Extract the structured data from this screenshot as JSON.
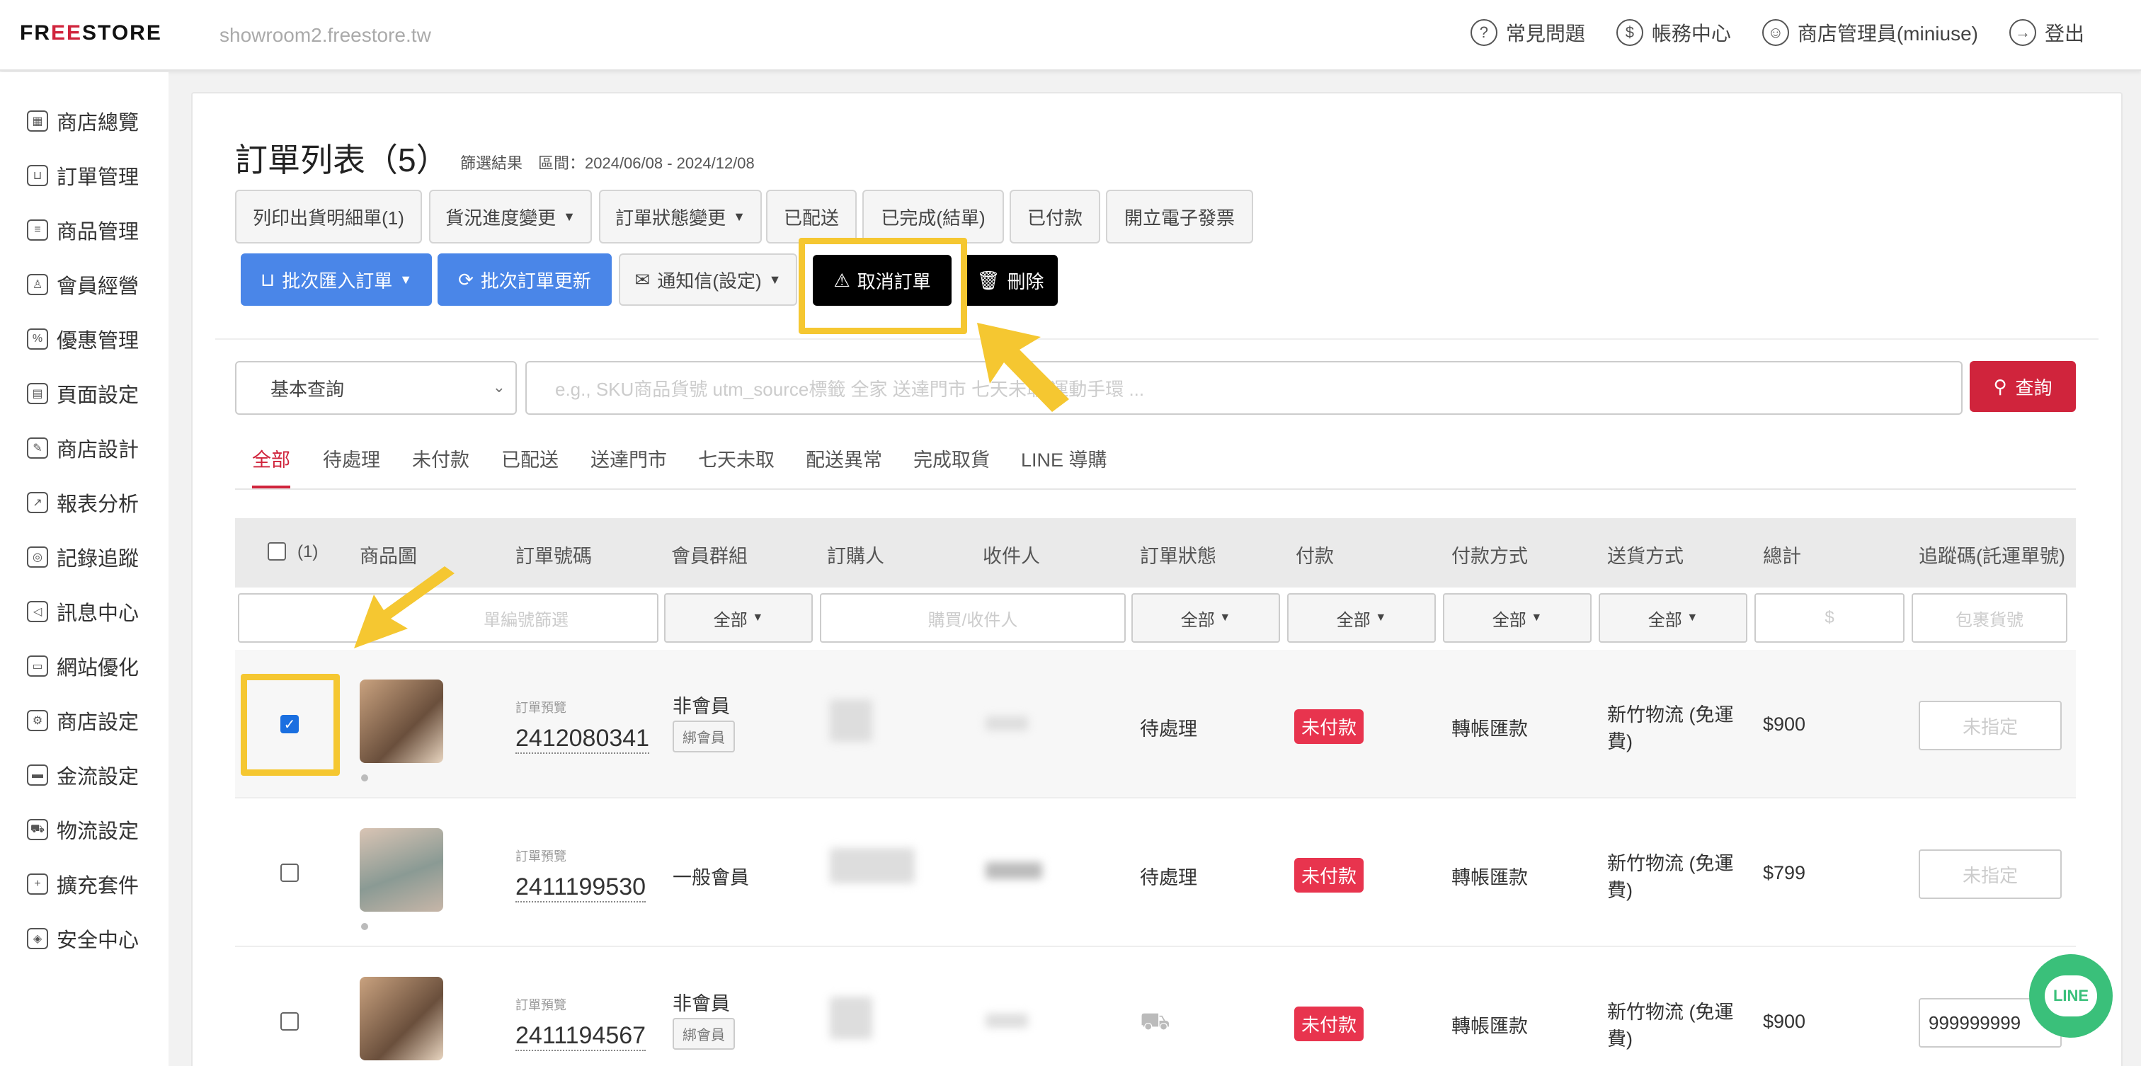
{
  "header": {
    "logo": "FREESTORE",
    "domain": "showroom2.freestore.tw",
    "nav": [
      {
        "icon": "question-icon",
        "label": "常見問題"
      },
      {
        "icon": "dollar-icon",
        "label": "帳務中心"
      },
      {
        "icon": "user-icon",
        "label": "商店管理員(miniuse)"
      },
      {
        "icon": "logout-icon",
        "label": "登出"
      }
    ]
  },
  "sidebar": {
    "items": [
      {
        "label": "商店總覽"
      },
      {
        "label": "訂單管理"
      },
      {
        "label": "商品管理"
      },
      {
        "label": "會員經營"
      },
      {
        "label": "優惠管理"
      },
      {
        "label": "頁面設定"
      },
      {
        "label": "商店設計"
      },
      {
        "label": "報表分析"
      },
      {
        "label": "記錄追蹤"
      },
      {
        "label": "訊息中心"
      },
      {
        "label": "網站優化"
      },
      {
        "label": "商店設定"
      },
      {
        "label": "金流設定"
      },
      {
        "label": "物流設定"
      },
      {
        "label": "擴充套件"
      },
      {
        "label": "安全中心"
      }
    ]
  },
  "main": {
    "title": "訂單列表（5）",
    "subtitle": "篩選結果　區間：2024/06/08 - 2024/12/08",
    "toolbar_row1": [
      "列印出貨明細單(1)",
      "貨況進度變更",
      "訂單狀態變更",
      "已配送",
      "已完成(結單)",
      "已付款",
      "開立電子發票"
    ],
    "toolbar_row2": {
      "import": "批次匯入訂單",
      "update": "批次訂單更新",
      "notify": "通知信(設定)",
      "cancel": "取消訂單",
      "delete": "刪除"
    },
    "search": {
      "mode": "基本查詢",
      "placeholder": "e.g., SKU商品貨號   utm_source標籤   全家   送達門市   七天未取   運動手環   ...",
      "button": "查詢"
    },
    "tabs": [
      "全部",
      "待處理",
      "未付款",
      "已配送",
      "送達門市",
      "七天未取",
      "配送異常",
      "完成取貨",
      "LINE 導購"
    ],
    "columns": {
      "select_count": "(1)",
      "image": "商品圖",
      "order_no": "訂單號碼",
      "member_group": "會員群組",
      "buyer": "訂購人",
      "receiver": "收件人",
      "status": "訂單狀態",
      "payment": "付款",
      "payment_method": "付款方式",
      "shipping": "送貨方式",
      "total": "總計",
      "tracking": "追蹤碼(託運單號)"
    },
    "filters": {
      "order_no_placeholder": "單編號篩選",
      "all": "全部",
      "buyer_placeholder": "購買/收件人",
      "total_placeholder": "$",
      "tracking_placeholder": "包裹貨號"
    },
    "rows": [
      {
        "checked": true,
        "preview": "訂單預覽",
        "order_no": "2412080341",
        "member": "非會員",
        "bind": "綁會員",
        "status": "待處理",
        "payment": "未付款",
        "method": "轉帳匯款",
        "shipping_line1": "新竹物流 (免運",
        "shipping_line2": "費)",
        "total": "$900",
        "tracking": "未指定"
      },
      {
        "checked": false,
        "preview": "訂單預覽",
        "order_no": "2411199530",
        "member": "一般會員",
        "bind": "",
        "status": "待處理",
        "payment": "未付款",
        "method": "轉帳匯款",
        "shipping_line1": "新竹物流 (免運",
        "shipping_line2": "費)",
        "total": "$799",
        "tracking": "未指定"
      },
      {
        "checked": false,
        "preview": "訂單預覽",
        "order_no": "2411194567",
        "member": "非會員",
        "bind": "綁會員",
        "status": "",
        "payment": "未付款",
        "method": "轉帳匯款",
        "shipping_line1": "新竹物流 (免運",
        "shipping_line2": "費)",
        "total": "$900",
        "tracking": "999999999"
      }
    ]
  },
  "line_chat": "LINE",
  "colors": {
    "brand_red": "#d0243c",
    "blue": "#4a86e8",
    "highlight": "#f5c731",
    "badge_red": "#e8344e",
    "line_green": "#3ac07a"
  }
}
